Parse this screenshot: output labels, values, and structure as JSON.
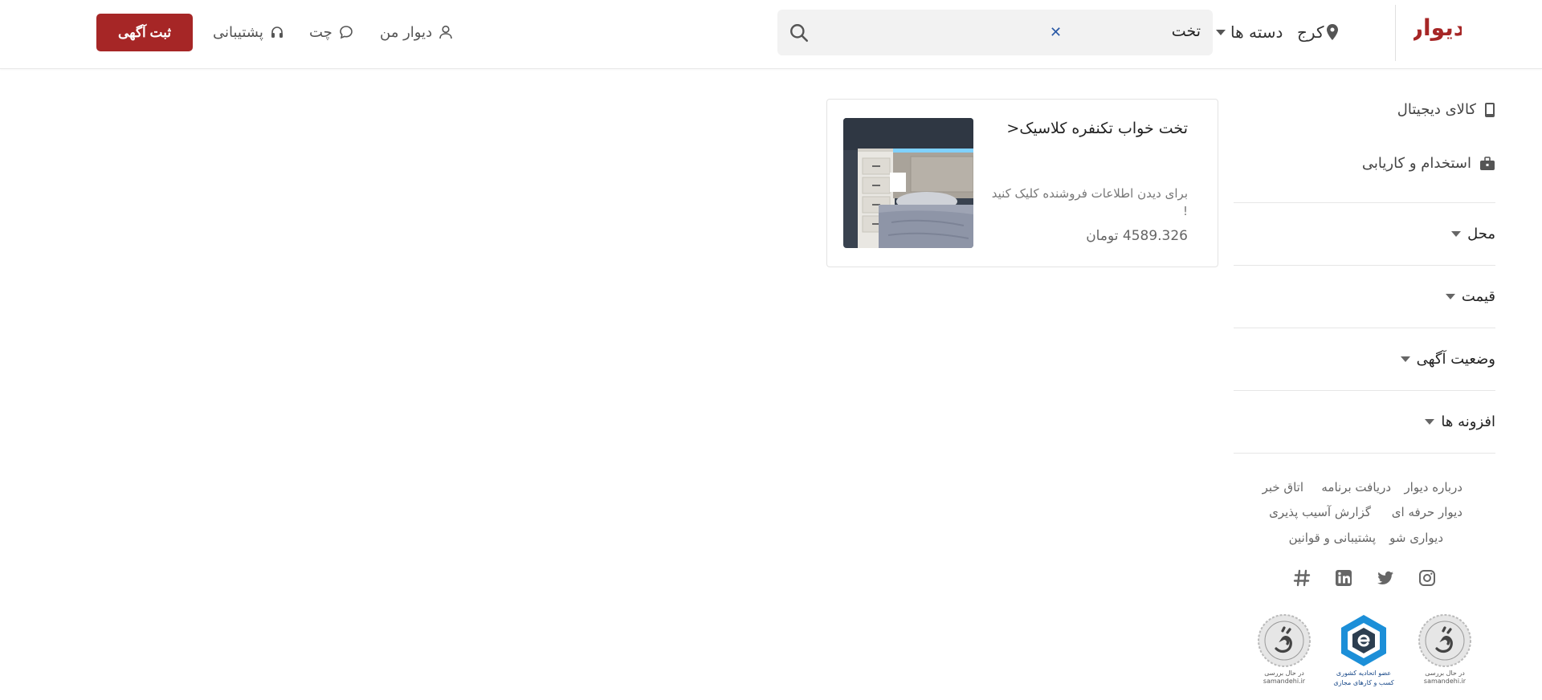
{
  "header": {
    "logo_text": "دیوار",
    "city": "کرج",
    "categories_label": "دسته ها",
    "search_value": "تخت",
    "clear_icon": "close-icon",
    "nav": {
      "my_divar": "دیوار من",
      "chat": "چت",
      "support": "پشتیبانی"
    },
    "post_button": "ثبت آگهی",
    "brand_color": "#a62626"
  },
  "sidebar": {
    "links": [
      {
        "label": "کالای دیجیتال",
        "icon": "mobile-icon"
      },
      {
        "label": "استخدام و کاریابی",
        "icon": "briefcase-icon"
      }
    ],
    "filters": [
      "محل",
      "قیمت",
      "وضعیت آگهی",
      "افزونه ها"
    ],
    "footer_links": {
      "row1": [
        "درباره دیوار",
        "دریافت برنامه",
        "اتاق خبر"
      ],
      "row2": [
        "دیوار حرفه ای",
        "گزارش آسیب پذیری"
      ],
      "row3": [
        "دیواری شو",
        "پشتیبانی و قوانین"
      ]
    },
    "social_icons": [
      "instagram-icon",
      "twitter-icon",
      "linkedin-icon",
      "hashtag-icon"
    ],
    "badges": [
      {
        "caption": "در حال بررسی",
        "sub": "samandehi.ir"
      },
      {
        "caption": "عضو اتحادیه کشوری",
        "sub": "کسب و کارهای مجازی"
      },
      {
        "caption": "در حال بررسی",
        "sub": "samandehi.ir"
      }
    ]
  },
  "listing": {
    "title": "تخت خواب تکنفره کلاسیک<",
    "description": "برای دیدن اطلاعات فروشنده کلیک کنید !",
    "price": "4589.326 تومان"
  }
}
